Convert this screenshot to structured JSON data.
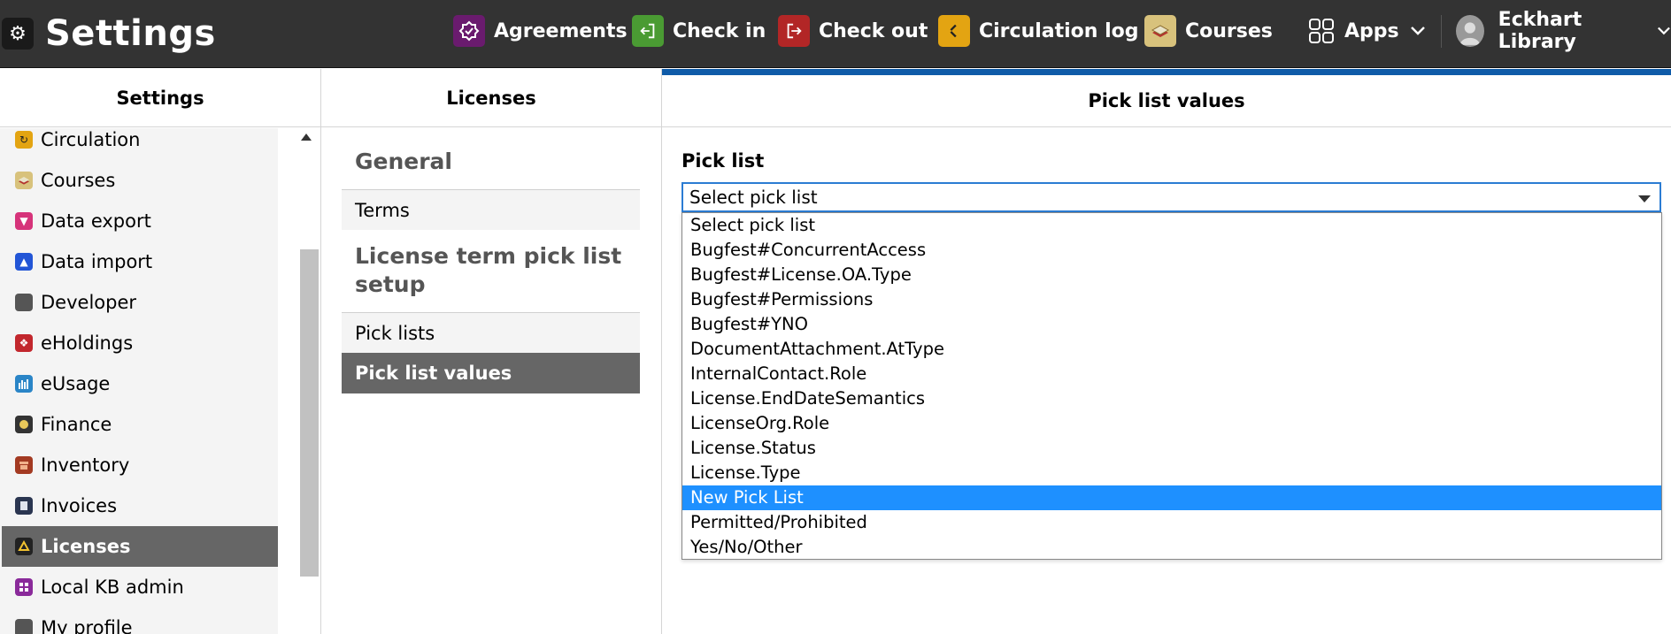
{
  "topbar": {
    "title": "Settings",
    "nav": [
      {
        "label": "Agreements",
        "icon": "agreements-icon",
        "color": "#6a1b6e"
      },
      {
        "label": "Check in",
        "icon": "check-in-icon",
        "color": "#4a9b33"
      },
      {
        "label": "Check out",
        "icon": "check-out-icon",
        "color": "#b22626"
      },
      {
        "label": "Circulation log",
        "icon": "circulation-log-icon",
        "color": "#e3a412"
      },
      {
        "label": "Courses",
        "icon": "courses-icon",
        "color": "#d8c27c"
      }
    ],
    "apps_label": "Apps",
    "user_label": "Eckhart Library"
  },
  "columns": {
    "settings": "Settings",
    "licenses": "Licenses",
    "values": "Pick list values"
  },
  "settings_nav": [
    {
      "label": "Circulation",
      "icon": "circulation-icon",
      "color": "#e3a412"
    },
    {
      "label": "Courses",
      "icon": "courses-icon",
      "color": "#d8c27c"
    },
    {
      "label": "Data export",
      "icon": "data-export-icon",
      "color": "#d6337a"
    },
    {
      "label": "Data import",
      "icon": "data-import-icon",
      "color": "#2255d6"
    },
    {
      "label": "Developer",
      "icon": "developer-icon",
      "color": "#555555"
    },
    {
      "label": "eHoldings",
      "icon": "eholdings-icon",
      "color": "#c2272d"
    },
    {
      "label": "eUsage",
      "icon": "eusage-icon",
      "color": "#2a85c7"
    },
    {
      "label": "Finance",
      "icon": "finance-icon",
      "color": "#333333"
    },
    {
      "label": "Inventory",
      "icon": "inventory-icon",
      "color": "#a33a22"
    },
    {
      "label": "Invoices",
      "icon": "invoices-icon",
      "color": "#2a3550"
    },
    {
      "label": "Licenses",
      "icon": "licenses-icon",
      "color": "#222222",
      "active": true
    },
    {
      "label": "Local KB admin",
      "icon": "local-kb-admin-icon",
      "color": "#8a2a9a"
    },
    {
      "label": "My profile",
      "icon": "my-profile-icon",
      "color": "#555555"
    }
  ],
  "licenses_pane": {
    "general_heading": "General",
    "terms_label": "Terms",
    "picklist_heading_line1": "License term pick list",
    "picklist_heading_line2": "setup",
    "pick_lists_label": "Pick lists",
    "pick_list_values_label": "Pick list values"
  },
  "values_pane": {
    "field_label": "Pick list",
    "select_value": "Select pick list",
    "options": [
      "Select pick list",
      "Bugfest#ConcurrentAccess",
      "Bugfest#License.OA.Type",
      "Bugfest#Permissions",
      "Bugfest#YNO",
      "DocumentAttachment.AtType",
      "InternalContact.Role",
      "License.EndDateSemantics",
      "LicenseOrg.Role",
      "License.Status",
      "License.Type",
      "New Pick List",
      "Permitted/Prohibited",
      "Yes/No/Other"
    ],
    "highlighted_option": "New Pick List",
    "accent_color": "#0f5ba8",
    "highlight_color": "#1e90ff"
  }
}
